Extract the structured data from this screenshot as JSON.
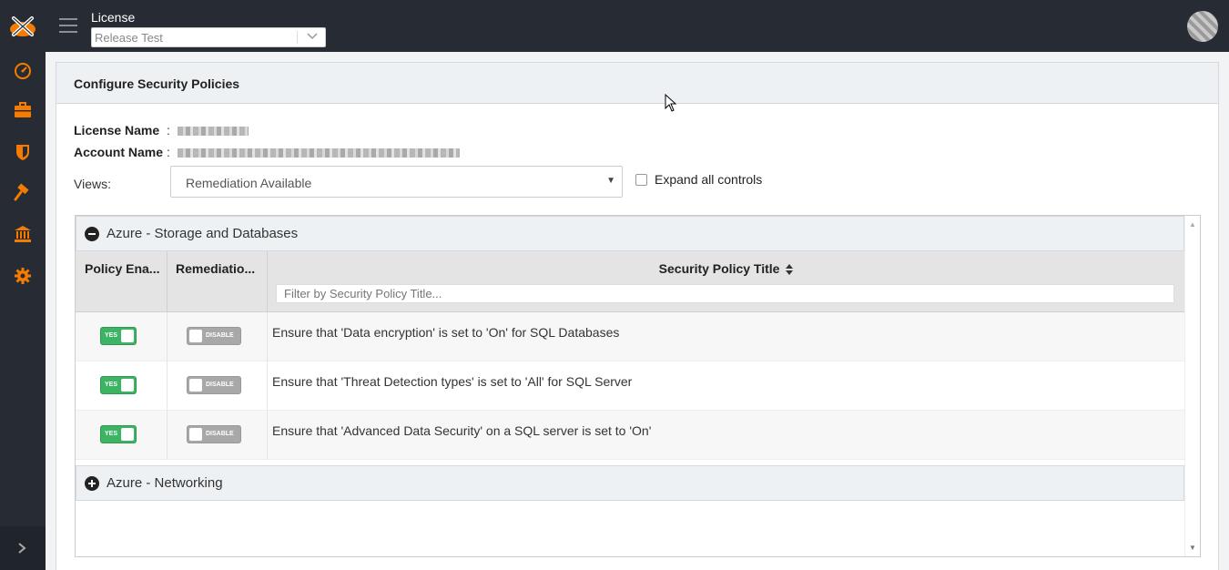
{
  "header": {
    "license_label": "License",
    "license_value": "Release Test"
  },
  "panel": {
    "title": "Configure Security Policies",
    "license_name_label": "License Name",
    "account_name_label": "Account Name",
    "separator": ":",
    "views_label": "Views:",
    "views_value": "Remediation Available",
    "expand_label": "Expand all controls"
  },
  "groups": [
    {
      "title": "Azure - Storage and Databases",
      "expanded": true
    },
    {
      "title": "Azure - Networking",
      "expanded": false
    }
  ],
  "table": {
    "headers": [
      "Policy Ena...",
      "Remediatio...",
      "Security Policy Title"
    ],
    "filter_placeholder": "Filter by Security Policy Title...",
    "toggle_yes": "YES",
    "toggle_disable": "DISABLE",
    "rows": [
      {
        "title": "Ensure that 'Data encryption' is set to 'On' for SQL Databases"
      },
      {
        "title": "Ensure that 'Threat Detection types' is set to 'All' for SQL Server"
      },
      {
        "title": "Ensure that 'Advanced Data Security' on a SQL server is set to 'On'"
      }
    ]
  },
  "colors": {
    "sidebar": "#272b33",
    "accent": "#f57c00",
    "toggle_on": "#3cb464",
    "toggle_off": "#a8a8a8"
  }
}
